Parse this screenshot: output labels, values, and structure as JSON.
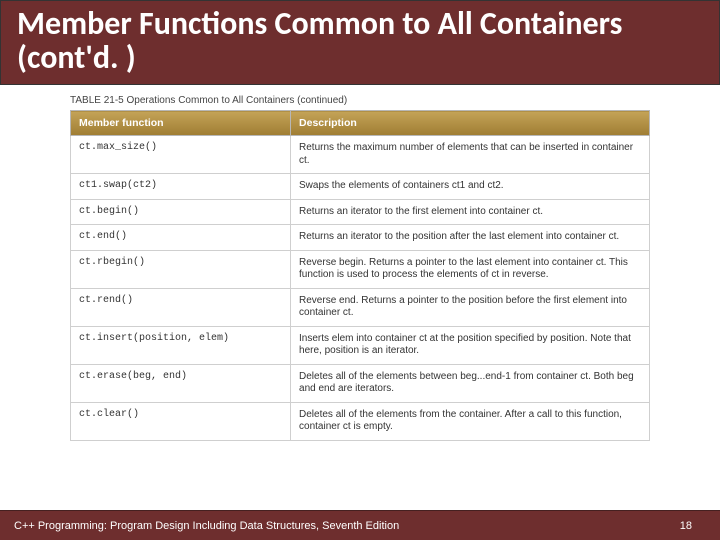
{
  "title": "Member Functions Common to All Containers (cont'd. )",
  "table_caption": "TABLE 21-5  Operations Common to All Containers (continued)",
  "columns": {
    "fn": "Member function",
    "desc": "Description"
  },
  "rows": [
    {
      "fn": "ct.max_size()",
      "desc": "Returns the maximum number of elements that can be inserted in container ct."
    },
    {
      "fn": "ct1.swap(ct2)",
      "desc": "Swaps the elements of containers ct1 and ct2."
    },
    {
      "fn": "ct.begin()",
      "desc": "Returns an iterator to the first element into container ct."
    },
    {
      "fn": "ct.end()",
      "desc": "Returns an iterator to the position after the last element into container ct."
    },
    {
      "fn": "ct.rbegin()",
      "desc": "Reverse begin. Returns a pointer to the last element into container ct. This function is used to process the elements of ct in reverse."
    },
    {
      "fn": "ct.rend()",
      "desc": "Reverse end. Returns a pointer to the position before the first element into container ct."
    },
    {
      "fn": "ct.insert(position, elem)",
      "desc": "Inserts elem into container ct at the position specified by position. Note that here, position is an iterator."
    },
    {
      "fn": "ct.erase(beg, end)",
      "desc": "Deletes all of the elements between beg...end-1 from container ct. Both beg and end are iterators."
    },
    {
      "fn": "ct.clear()",
      "desc": "Deletes all of the elements from the container. After a call to this function, container ct is empty."
    }
  ],
  "footer": {
    "text": "C++ Programming: Program Design Including Data Structures, Seventh Edition",
    "page": "18"
  }
}
